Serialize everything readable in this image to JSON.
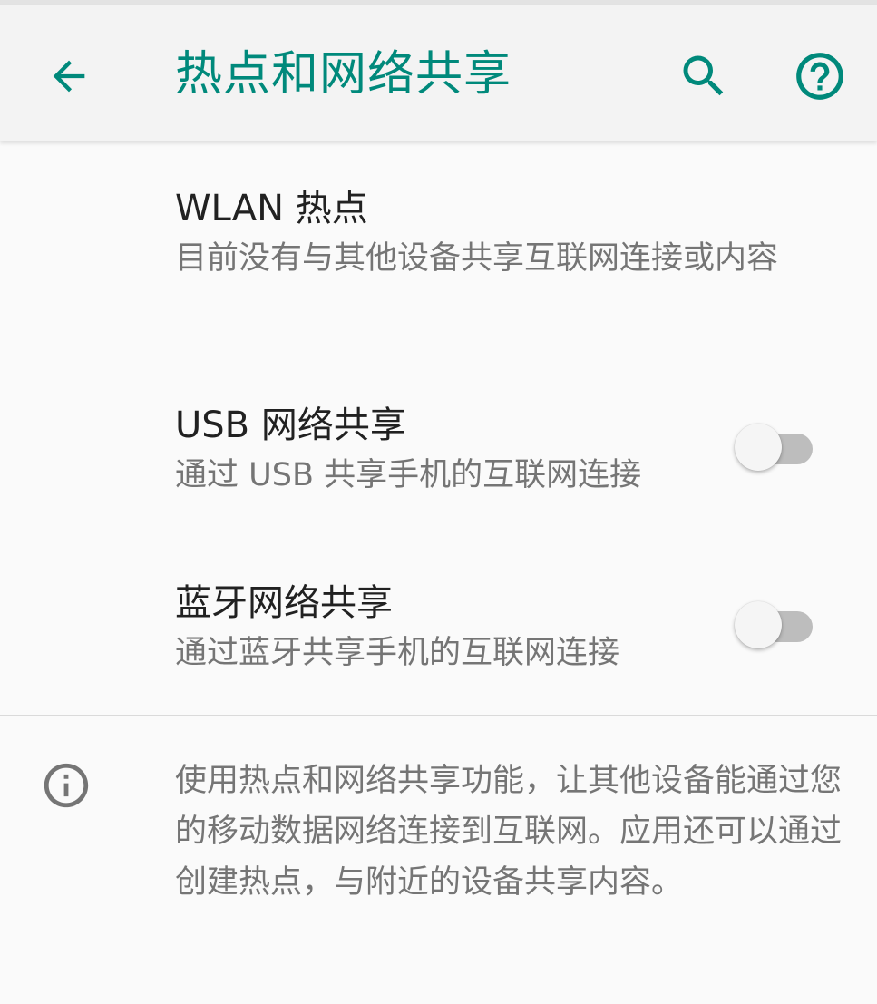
{
  "colors": {
    "accent": "#00897b",
    "primary_text": "#212121",
    "secondary_text": "#757575",
    "toolbar_bg": "#f3f3f3",
    "page_bg": "#fafafa"
  },
  "toolbar": {
    "back_icon": "arrow-back-icon",
    "title": "热点和网络共享",
    "search_icon": "search-icon",
    "help_icon": "help-circle-icon"
  },
  "preferences": [
    {
      "title": "WLAN 热点",
      "summary": "目前没有与其他设备共享互联网连接或内容",
      "has_toggle": false
    },
    {
      "title": "USB 网络共享",
      "summary": "通过 USB 共享手机的互联网连接",
      "has_toggle": true,
      "toggle_on": false
    },
    {
      "title": "蓝牙网络共享",
      "summary": "通过蓝牙共享手机的互联网连接",
      "has_toggle": true,
      "toggle_on": false
    }
  ],
  "footer": {
    "icon": "info-icon",
    "text": "使用热点和网络共享功能，让其他设备能通过您的移动数据网络连接到互联网。应用还可以通过创建热点，与附近的设备共享内容。"
  }
}
